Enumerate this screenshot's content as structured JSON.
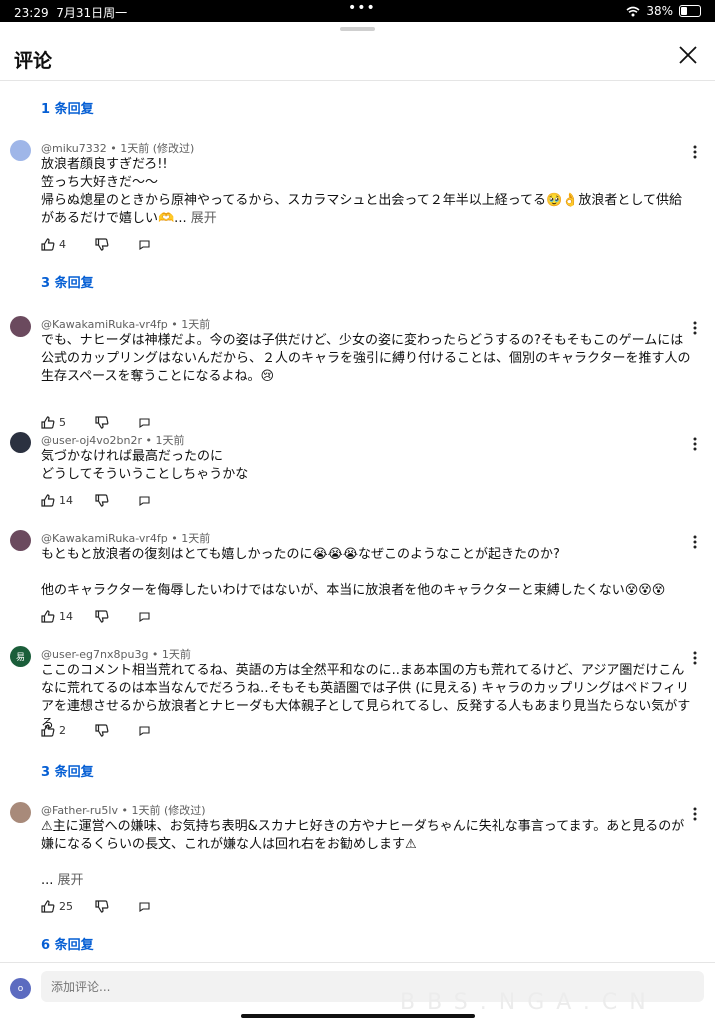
{
  "status_bar": {
    "time": "23:29",
    "date": "7月31日周一",
    "battery": "38%"
  },
  "header": {
    "title": "评论"
  },
  "reply_links": [
    "1 条回复",
    "3 条回复",
    "3 条回复",
    "6 条回复"
  ],
  "comments": [
    {
      "author": "@miku7332",
      "time": "1天前 (修改过)",
      "avatar_color": "#9fb6e8",
      "text": "放浪者顔良すぎだろ!!\n笠っち大好きだ～～\n帰らぬ熄星のときから原神やってるから、スカラマシュと出会って２年半以上経ってる🥹👌放浪者として供給があるだけで嬉しい🫶...",
      "expand": "展开",
      "likes": "4"
    },
    {
      "author": "@KawakamiRuka-vr4fp",
      "time": "1天前",
      "avatar_color": "#6b4a5e",
      "text": "でも、ナヒーダは神様だよ。今の姿は子供だけど、少女の姿に変わったらどうするの?そもそもこのゲームには公式のカップリングはないんだから、２人のキャラを強引に縛り付けることは、個別のキャラクターを推す人の生存スペースを奪うことになるよね。😢",
      "likes": "5"
    },
    {
      "author": "@user-oj4vo2bn2r",
      "time": "1天前",
      "avatar_color": "#2b3140",
      "text": "気づかなければ最高だったのに\nどうしてそういうことしちゃうかな",
      "likes": "14"
    },
    {
      "author": "@KawakamiRuka-vr4fp",
      "time": "1天前",
      "avatar_color": "#6b4a5e",
      "text": "もともと放浪者の復刻はとても嬉しかったのに😭😭😭なぜこのようなことが起きたのか?\n\n他のキャラクターを侮辱したいわけではないが、本当に放浪者を他のキャラクターと束縛したくない😵😵😵",
      "likes": "14"
    },
    {
      "author": "@user-eg7nx8pu3g",
      "time": "1天前",
      "avatar_color": "#1b5e3a",
      "avatar_letter": "易",
      "text": "ここのコメント相当荒れてるね、英語の方は全然平和なのに..まあ本国の方も荒れてるけど、アジア圏だけこんなに荒れてるのは本当なんでだろうね..そもそも英語圏では子供 (に見える) キャラのカップリングはペドフィリアを連想させるから放浪者とナヒーダも大体親子として見られてるし、反発する人もあまり見当たらない気がする",
      "likes": "2"
    },
    {
      "author": "@Father-ru5lv",
      "time": "1天前 (修改过)",
      "avatar_color": "#a88a7a",
      "text": "⚠主に運営への嫌味、お気持ち表明&スカナヒ好きの方やナヒーダちゃんに失礼な事言ってます。あと見るのが嫌になるくらいの長文、これが嫌な人は回れ右をお勧めします⚠\n\n...",
      "expand": "展开",
      "likes": "25"
    }
  ],
  "bottom": {
    "avatar_letter": "o",
    "input_placeholder": "添加评论...",
    "watermark": "BBS.NGA.CN"
  },
  "icons": {
    "wifi": "wifi-icon",
    "battery": "battery-icon",
    "close": "close-icon",
    "like": "thumbs-up-icon",
    "dislike": "thumbs-down-icon",
    "reply": "reply-icon",
    "more": "more-vert-icon"
  },
  "colors": {
    "link": "#065fd4",
    "meta": "#606060"
  }
}
